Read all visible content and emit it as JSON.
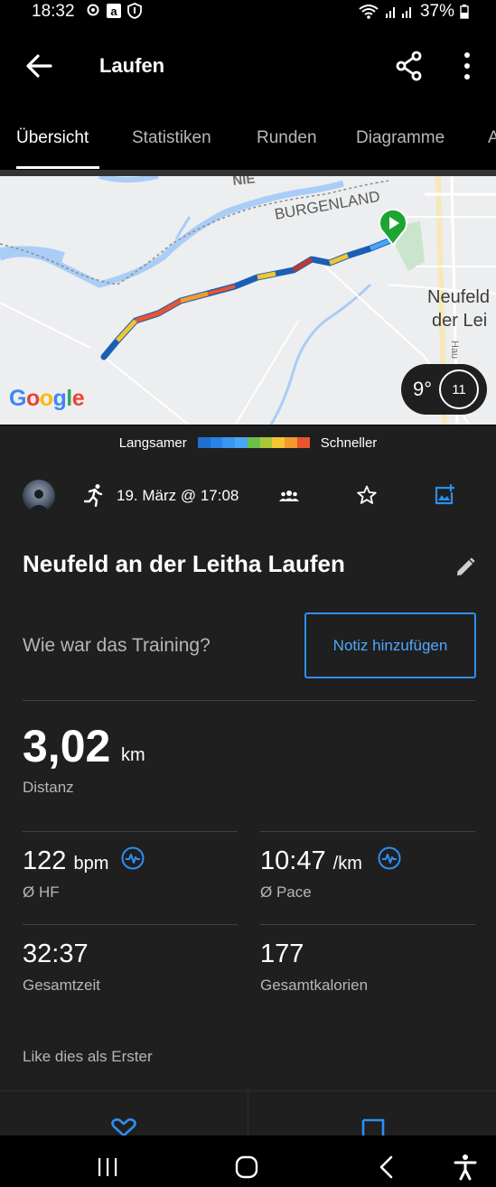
{
  "status_bar": {
    "time": "18:32",
    "battery": "37%",
    "icons": [
      "settings-gear-icon",
      "amazon-app-icon",
      "security-shield-icon",
      "wifi-icon",
      "signal-icon",
      "battery-icon"
    ]
  },
  "app_bar": {
    "title": "Laufen",
    "icons": [
      "back-arrow-icon",
      "share-icon",
      "more-vertical-icon"
    ]
  },
  "tabs": [
    {
      "label": "Übersicht",
      "active": true
    },
    {
      "label": "Statistiken",
      "active": false
    },
    {
      "label": "Runden",
      "active": false
    },
    {
      "label": "Diagramme",
      "active": false
    },
    {
      "label": "A",
      "active": false
    }
  ],
  "map": {
    "labels": {
      "region": "BURGENLAND",
      "region_partial": "NIE",
      "town_line1": "Neufeld",
      "town_line2": "der Lei",
      "street": "Hau"
    },
    "google_logo": "Google",
    "weather": {
      "temperature": "9°",
      "wind": "11"
    }
  },
  "legend": {
    "slower": "Langsamer",
    "faster": "Schneller",
    "colors": [
      "#1f6fd0",
      "#2b82e8",
      "#3a96f0",
      "#48a6f3",
      "#6cc04a",
      "#a8c83a",
      "#f2c531",
      "#f39a2f",
      "#e8552e"
    ]
  },
  "activity": {
    "date": "19. März @ 17:08",
    "name": "Neufeld an der Leitha Laufen",
    "question": "Wie war das Training?",
    "note_button": "Notiz hinzufügen",
    "distance": {
      "value": "3,02",
      "unit": "km",
      "label": "Distanz"
    },
    "heart_rate": {
      "value": "122",
      "unit": "bpm",
      "label": "Ø HF"
    },
    "pace": {
      "value": "10:47",
      "unit": "/km",
      "label": "Ø Pace"
    },
    "total_time": {
      "value": "32:37",
      "label": "Gesamtzeit"
    },
    "calories": {
      "value": "177",
      "label": "Gesamtkalorien"
    },
    "likes": "Like dies als Erster"
  },
  "accent_color": "#2d8ff0"
}
